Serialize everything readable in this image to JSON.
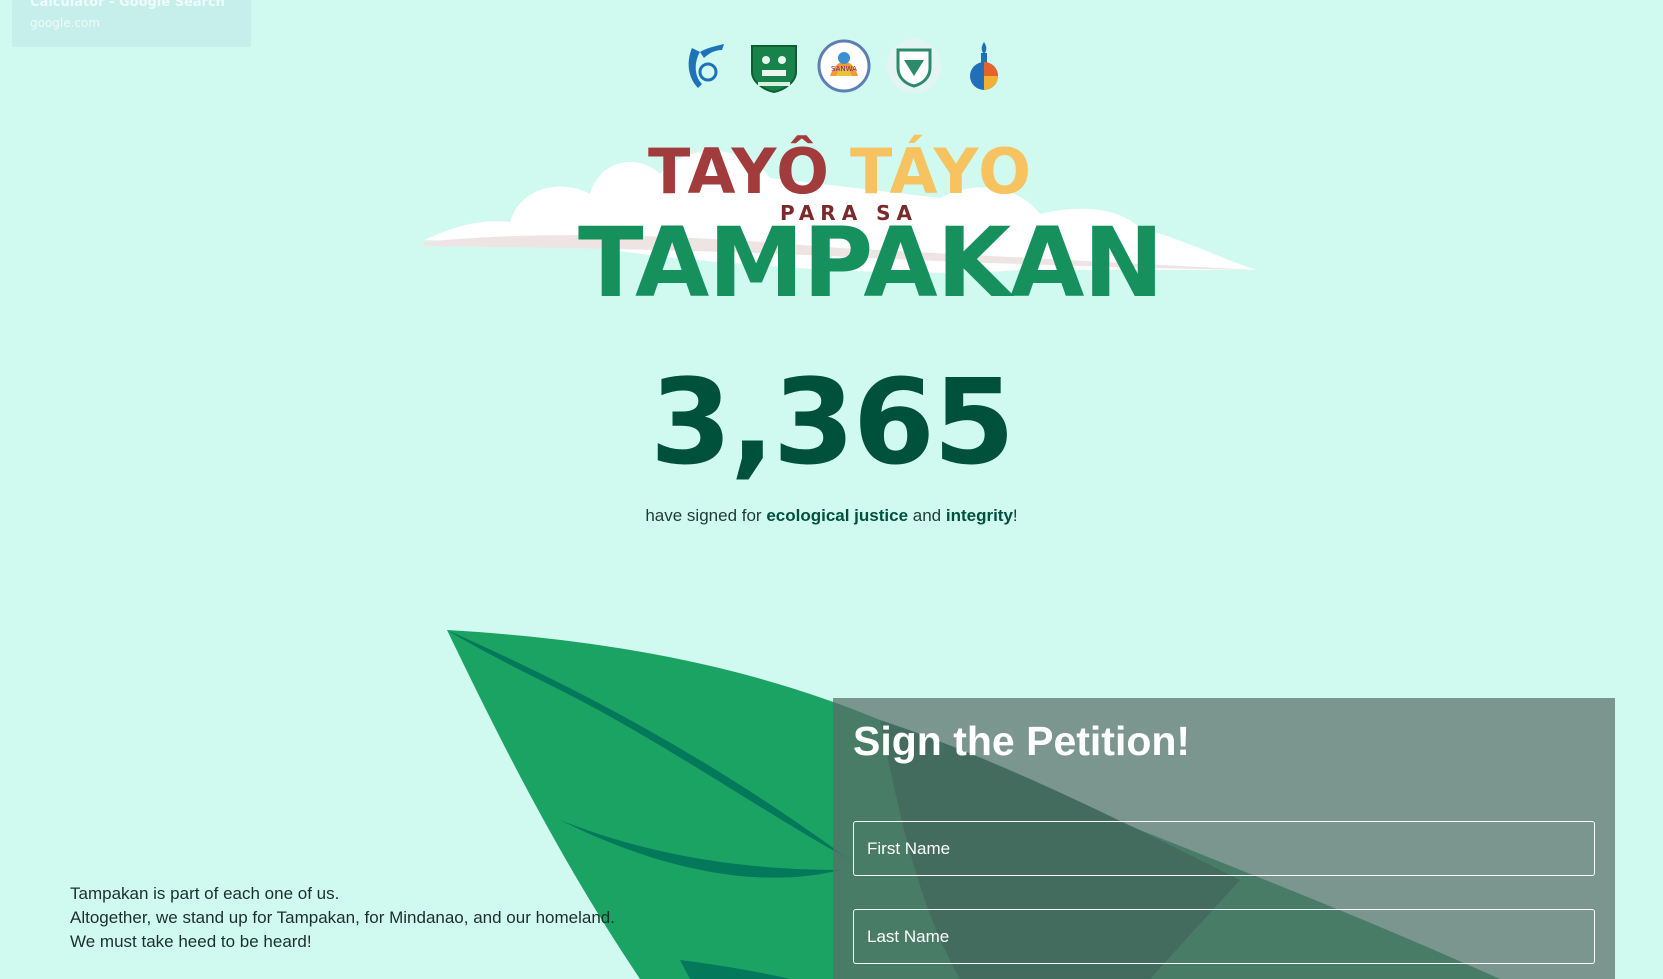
{
  "toast": {
    "title": "Calculator - Google Search",
    "subtitle": "google.com"
  },
  "logos": [
    "diocese-seal-icon",
    "tribal-council-shield-icon",
    "sanwa-seal-icon",
    "church-shield-icon",
    "torch-figure-icon"
  ],
  "hero": {
    "line1_a": "TAYÔ",
    "line1_b": "TÁYO",
    "line2": "PARA SA",
    "line3": "TAMPAKAN"
  },
  "counter": {
    "value": "3,365",
    "text_before": "have signed for ",
    "emphasis1": "ecological justice",
    "text_mid": " and ",
    "emphasis2": "integrity",
    "text_after": "!"
  },
  "blurb": [
    "Tampakan is part of each one of us.",
    "Altogether, we stand up for Tampakan, for Mindanao, and our homeland.",
    "We must take heed to be heard!"
  ],
  "petition": {
    "title": "Sign the Petition!",
    "first_name_placeholder": "First Name",
    "last_name_placeholder": "Last Name"
  },
  "colors": {
    "background": "#d0faf0",
    "counter": "#00513b",
    "leaf_light": "#1aa363",
    "leaf_dark": "#03785a",
    "title_red": "#a23c3c",
    "title_yellow": "#f7c260",
    "title_green": "#16915d"
  }
}
